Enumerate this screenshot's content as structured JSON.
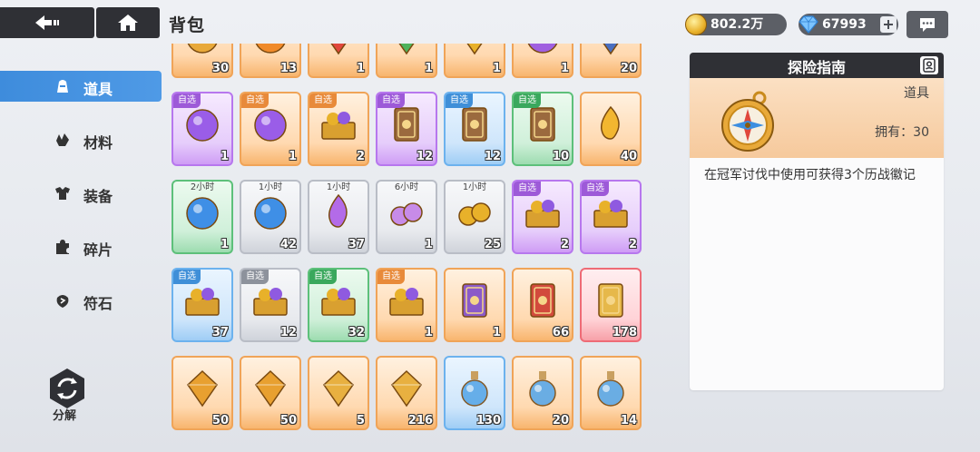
{
  "header": {
    "title": "背包",
    "gold": "802.2万",
    "gems": "67993"
  },
  "colors": {
    "nav_active": "#3e8cdc",
    "dark_bar": "#2f3035",
    "rarity": {
      "purple": "#b777ee",
      "orange": "#f0a458",
      "blue": "#6cb2ee",
      "green": "#5dc07a",
      "gray": "#b9bdc6",
      "red": "#ee6b76"
    }
  },
  "nav": {
    "items": [
      {
        "label": "道具",
        "icon": "bag-icon",
        "active": true
      },
      {
        "label": "材料",
        "icon": "crystal-icon",
        "active": false
      },
      {
        "label": "装备",
        "icon": "armor-icon",
        "active": false
      },
      {
        "label": "碎片",
        "icon": "puzzle-piece-icon",
        "active": false
      },
      {
        "label": "符石",
        "icon": "rune-stone-icon",
        "active": false
      }
    ],
    "decompose_label": "分解"
  },
  "grid": {
    "rows": [
      [
        {
          "rarity": "orange",
          "count": "30",
          "icon": "compass-icon"
        },
        {
          "rarity": "orange",
          "count": "13",
          "icon": "fire-orb-icon"
        },
        {
          "rarity": "orange",
          "count": "1",
          "icon": "red-gem-icon"
        },
        {
          "rarity": "orange",
          "count": "1",
          "icon": "green-leaf-gem-icon"
        },
        {
          "rarity": "orange",
          "count": "1",
          "icon": "yellow-gem-icon"
        },
        {
          "rarity": "orange",
          "count": "1",
          "icon": "purple-crystal-ball-icon"
        },
        {
          "rarity": "orange",
          "count": "20",
          "icon": "blue-crystal-icon"
        }
      ],
      [
        {
          "rarity": "purple",
          "tag": "自选",
          "count": "1",
          "icon": "crystal-ball-icon"
        },
        {
          "rarity": "orange",
          "tag": "自选",
          "count": "1",
          "icon": "crystal-ball-icon"
        },
        {
          "rarity": "orange",
          "tag": "自选",
          "count": "2",
          "icon": "golden-chest-icon"
        },
        {
          "rarity": "purple",
          "tag": "自选",
          "count": "12",
          "icon": "framed-picture-icon"
        },
        {
          "rarity": "blue",
          "tag": "自选",
          "count": "12",
          "icon": "framed-picture-icon"
        },
        {
          "rarity": "green",
          "tag": "自选",
          "count": "10",
          "icon": "framed-picture-icon"
        },
        {
          "rarity": "orange",
          "count": "40",
          "icon": "golden-flame-icon"
        }
      ],
      [
        {
          "rarity": "green",
          "time": "2小时",
          "count": "1",
          "icon": "blue-orbs-icon"
        },
        {
          "rarity": "gray",
          "time": "1小时",
          "count": "42",
          "icon": "blue-orbs-icon"
        },
        {
          "rarity": "gray",
          "time": "1小时",
          "count": "37",
          "icon": "purple-flames-icon"
        },
        {
          "rarity": "gray",
          "time": "6小时",
          "count": "1",
          "icon": "coin-bag-icon"
        },
        {
          "rarity": "gray",
          "time": "1小时",
          "count": "25",
          "icon": "gold-coins-icon"
        },
        {
          "rarity": "purple",
          "tag": "自选",
          "count": "2",
          "icon": "treasure-box-icon"
        },
        {
          "rarity": "purple",
          "tag": "自选",
          "count": "2",
          "icon": "treasure-box-icon"
        }
      ],
      [
        {
          "rarity": "blue",
          "tag": "自选",
          "count": "37",
          "icon": "treasure-box-icon"
        },
        {
          "rarity": "gray",
          "tag": "自选",
          "count": "12",
          "icon": "treasure-box-icon"
        },
        {
          "rarity": "green",
          "tag": "自选",
          "count": "32",
          "icon": "treasure-box-icon"
        },
        {
          "rarity": "orange",
          "tag": "自选",
          "count": "1",
          "icon": "golden-chest-icon"
        },
        {
          "rarity": "orange",
          "count": "1",
          "icon": "purple-card-icon"
        },
        {
          "rarity": "orange",
          "count": "66",
          "icon": "red-card-icon"
        },
        {
          "rarity": "red",
          "count": "178",
          "icon": "gold-card-icon"
        }
      ],
      [
        {
          "rarity": "orange",
          "count": "50",
          "icon": "pendulum-icon"
        },
        {
          "rarity": "orange",
          "count": "50",
          "icon": "pendulum-icon"
        },
        {
          "rarity": "orange",
          "count": "5",
          "icon": "star-charm-icon"
        },
        {
          "rarity": "orange",
          "count": "216",
          "icon": "star-charm-icon"
        },
        {
          "rarity": "blue",
          "count": "130",
          "icon": "potion-bottle-icon"
        },
        {
          "rarity": "orange",
          "count": "20",
          "icon": "potion-bottle-icon"
        },
        {
          "rarity": "orange",
          "count": "14",
          "icon": "potion-bottle-icon"
        }
      ]
    ]
  },
  "panel": {
    "title": "探险指南",
    "item_type": "道具",
    "owned": "拥有：30",
    "description": "在冠军讨伐中使用可获得3个历战徽记",
    "icon": "compass-icon"
  }
}
